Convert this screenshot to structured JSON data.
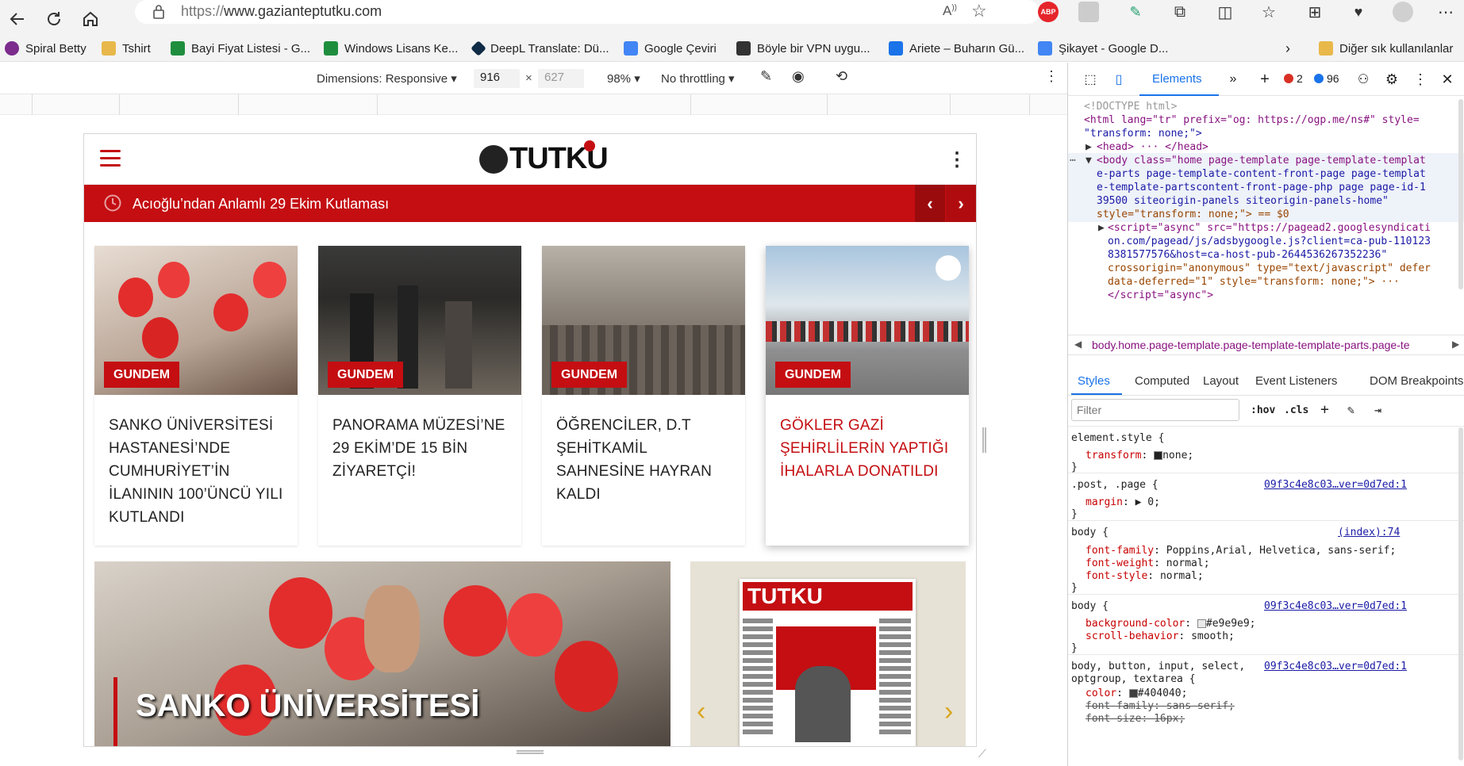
{
  "browser": {
    "url_protocol": "https://",
    "url_host": "www.gazianteptutku.com",
    "bookmarks": [
      {
        "label": "Spiral Betty",
        "icon": "spiral-icon",
        "color": "#7b2c8c"
      },
      {
        "label": "Tshirt",
        "icon": "folder-icon",
        "color": "#e8b84a"
      },
      {
        "label": "Bayi Fiyat Listesi - G...",
        "icon": "sheets-icon",
        "color": "#1e8e3e"
      },
      {
        "label": "Windows Lisans Ke...",
        "icon": "sheets-icon",
        "color": "#1e8e3e"
      },
      {
        "label": "DeepL Translate: Dü...",
        "icon": "deepl-icon",
        "color": "#0f2b46"
      },
      {
        "label": "Google Çeviri",
        "icon": "translate-icon",
        "color": "#4285f4"
      },
      {
        "label": "Böyle bir VPN uygu...",
        "icon": "vpn-icon",
        "color": "#333333"
      },
      {
        "label": "Ariete – Buharın Gü...",
        "icon": "ariete-icon",
        "color": "#1a73e8"
      },
      {
        "label": "Şikayet - Google D...",
        "icon": "docs-icon",
        "color": "#4285f4"
      },
      {
        "label": "Diğer sık kullanılanlar",
        "icon": "folder-icon",
        "color": "#e8b84a"
      }
    ]
  },
  "device_toolbar": {
    "dimensions": "Dimensions: Responsive",
    "width": "916",
    "height_placeholder": "627",
    "times": "×",
    "zoom": "98%",
    "throttling": "No throttling"
  },
  "site": {
    "logo_text": "TUTKU",
    "ticker_text": "Acıoğlu’ndan Anlamlı 29 Ekim Kutlaması",
    "cards": [
      {
        "tag": "GUNDEM",
        "title": "SANKO ÜNİVERSİTESİ HASTANESİ’NDE CUMHURİYET’İN İLANININ 100’ÜNCÜ YILI KUTLANDI"
      },
      {
        "tag": "GUNDEM",
        "title": "PANORAMA MÜZESİ’NE 29 EKİM’DE 15 BİN ZİYARETÇİ!"
      },
      {
        "tag": "GUNDEM",
        "title": "ÖĞRENCİLER, D.T ŞEHİTKAMİL SAHNESİNE HAYRAN KALDI"
      },
      {
        "tag": "GUNDEM",
        "title": "GÖKLER GAZİ ŞEHİRLİLERİN YAPTIĞI İHALARLA DONATILDI"
      }
    ],
    "hero_title": "SANKO ÜNİVERSİTESİ",
    "paper_masthead": "TUTKU",
    "accent_color": "#c40e12"
  },
  "devtools": {
    "tab_elements": "Elements",
    "errors": "2",
    "messages": "96",
    "dom_lines": [
      "<!DOCTYPE html>",
      "<html lang=\"tr\" prefix=\"og: https://ogp.me/ns#\" style=",
      "\"transform: none;\">",
      "<head> ··· </head>",
      "<body class=\"home page-template page-template-templat",
      "e-parts page-template-content-front-page page-templat",
      "e-template-partscontent-front-page-php page page-id-1",
      "39500 siteorigin-panels  siteorigin-panels-home\"",
      "style=\"transform: none;\"> == $0",
      "<script=\"async\" src=\"https://pagead2.googlesyndicati",
      "on.com/pagead/js/adsbygoogle.js?client=ca-pub-110123",
      "8381577576&host=ca-host-pub-2644536267352236\"",
      "crossorigin=\"anonymous\" type=\"text/javascript\" defer",
      "data-deferred=\"1\" style=\"transform: none;\"> ···",
      "</script=\"async\">"
    ],
    "breadcrumb": "body.home.page-template.page-template-template-parts.page-te",
    "subtabs": [
      "Styles",
      "Computed",
      "Layout",
      "Event Listeners",
      "DOM Breakpoints"
    ],
    "filter_placeholder": "Filter",
    "hov": ":hov",
    "cls": ".cls",
    "rules": [
      {
        "selector": "element.style {",
        "source": "",
        "props": [
          [
            "transform",
            "none;"
          ]
        ]
      },
      {
        "selector": ".post, .page {",
        "source": "09f3c4e8c03…ver=0d7ed:1",
        "props": [
          [
            "margin",
            "▶ 0;"
          ]
        ]
      },
      {
        "selector": "body {",
        "source": "(index):74",
        "props": [
          [
            "font-family",
            "Poppins,Arial, Helvetica, sans-serif;"
          ],
          [
            "font-weight",
            "normal;"
          ],
          [
            "font-style",
            "normal;"
          ]
        ]
      },
      {
        "selector": "body {",
        "source": "09f3c4e8c03…ver=0d7ed:1",
        "props": [
          [
            "background-color",
            "#e9e9e9;"
          ],
          [
            "scroll-behavior",
            "smooth;"
          ]
        ]
      },
      {
        "selector": "body, button, input, select,",
        "source": "09f3c4e8c03…ver=0d7ed:1",
        "props": []
      },
      {
        "selector": "optgroup, textarea {",
        "source": "",
        "props": [
          [
            "color",
            "#404040;"
          ],
          [
            "font-family",
            "sans-serif;"
          ],
          [
            "font-size",
            "16px;"
          ]
        ]
      }
    ]
  }
}
